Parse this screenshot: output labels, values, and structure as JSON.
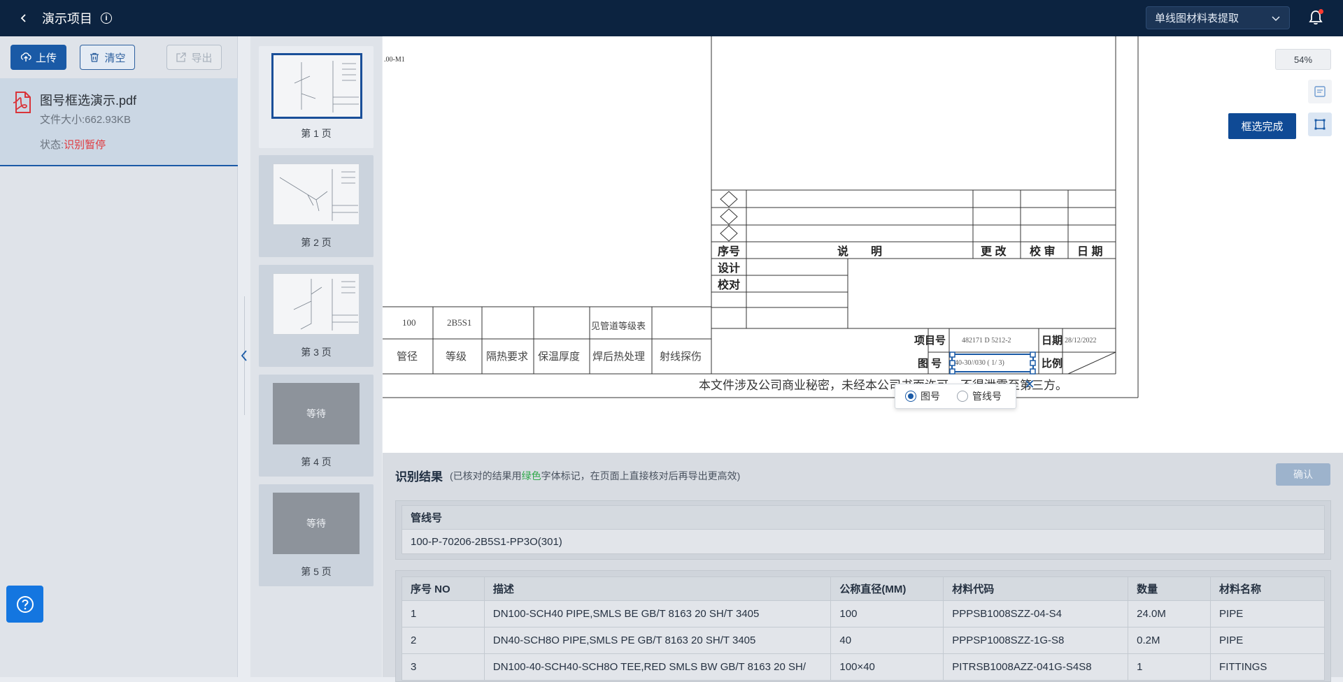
{
  "topbar": {
    "title": "演示项目",
    "info_icon": "i",
    "mode": "单线图材料表提取"
  },
  "left": {
    "upload_label": "上传",
    "clear_label": "清空",
    "export_label": "导出",
    "file": {
      "name": "图号框选演示.pdf",
      "size": "文件大小:662.93KB",
      "status_label": "状态:",
      "status_value": "识别暂停"
    }
  },
  "thumbnails": [
    {
      "label": "第 1 页",
      "state": "active"
    },
    {
      "label": "第 2 页",
      "state": "done"
    },
    {
      "label": "第 3 页",
      "state": "done"
    },
    {
      "label": "第 4 页",
      "state": "waiting",
      "wait_text": "等待"
    },
    {
      "label": "第 5 页",
      "state": "waiting",
      "wait_text": "等待"
    }
  ],
  "viewer": {
    "zoom": "54%",
    "done_label": "框选完成",
    "drawing": {
      "corner_text": ".00-M1",
      "rows": {
        "seq": "序号",
        "desc": "说　　明",
        "change": "更 改",
        "check": "校 审",
        "date": "日 期",
        "design": "设计",
        "proof": "校对"
      },
      "pipe_table": {
        "size_val": "100",
        "grade_val": "2B5S1",
        "stdnote": "见管道等级表",
        "size_lbl": "管径",
        "grade_lbl": "等级",
        "insul_lbl": "隔热要求",
        "thick_lbl": "保温厚度",
        "pwht_lbl": "焊后热处理",
        "ndt_lbl": "射线探伤"
      },
      "title_block": {
        "proj_lbl": "项目号",
        "proj_val": "482171 D 5212-2",
        "date_lbl": "日期",
        "date_val": "28/12/2022",
        "dwg_lbl": "图 号",
        "dwg_val": "40-30//030 (  1/  3)",
        "scale_lbl": "比例"
      },
      "notice": "本文件涉及公司商业秘密，未经本公司书面许可，不得泄露至第三方。"
    },
    "popup": {
      "option1": "图号",
      "option2": "管线号",
      "selected": "图号"
    }
  },
  "results": {
    "title": "识别结果",
    "hint_pre": "(已核对的结果用",
    "hint_green": "绿色",
    "hint_post": "字体标记，在页面上直接核对后再导出更高效)",
    "confirm_label": "确认",
    "pipe_header": "管线号",
    "pipe_value": "100-P-70206-2B5S1-PP3O(301)",
    "table": {
      "headers": [
        "序号 NO",
        "描述",
        "公称直径(MM)",
        "材料代码",
        "数量",
        "材料名称"
      ],
      "rows": [
        [
          "1",
          "DN100-SCH40 PIPE,SMLS BE GB/T 8163 20 SH/T 3405",
          "100",
          "PPPSB1008SZZ-04-S4",
          "24.0M",
          "PIPE"
        ],
        [
          "2",
          "DN40-SCH8O PIPE,SMLS PE GB/T 8163 20 SH/T 3405",
          "40",
          "PPPSP1008SZZ-1G-S8",
          "0.2M",
          "PIPE"
        ],
        [
          "3",
          "DN100-40-SCH40-SCH8O TEE,RED SMLS BW GB/T 8163 20 SH/",
          "100×40",
          "PITRSB1008AZZ-041G-S4S8",
          "1",
          "FITTINGS"
        ]
      ]
    }
  },
  "colors": {
    "topbar": "#0c2340",
    "accent": "#1a5aa6",
    "status_red": "#e0393e",
    "green": "#2fa84a"
  }
}
